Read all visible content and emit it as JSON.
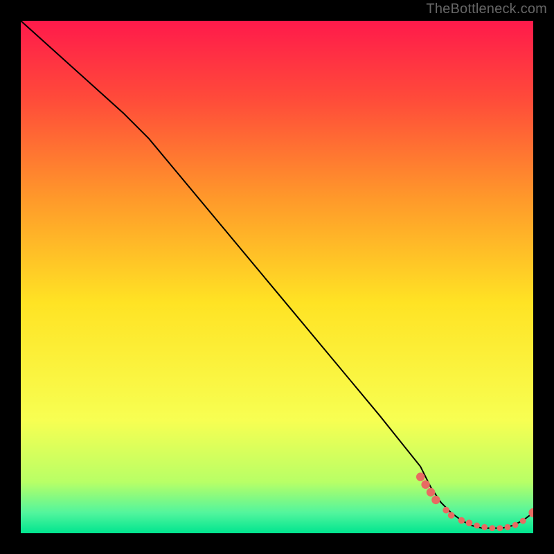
{
  "watermark": "TheBottleneck.com",
  "chart_data": {
    "type": "line",
    "title": "",
    "xlabel": "",
    "ylabel": "",
    "xlim": [
      0,
      100
    ],
    "ylim": [
      0,
      100
    ],
    "background": {
      "type": "vertical_gradient",
      "stops": [
        {
          "offset": 0.0,
          "color": "#ff1a4b"
        },
        {
          "offset": 0.15,
          "color": "#ff4a3a"
        },
        {
          "offset": 0.35,
          "color": "#ff9a2a"
        },
        {
          "offset": 0.55,
          "color": "#ffe324"
        },
        {
          "offset": 0.78,
          "color": "#f7ff52"
        },
        {
          "offset": 0.9,
          "color": "#b8ff66"
        },
        {
          "offset": 0.96,
          "color": "#52f59d"
        },
        {
          "offset": 1.0,
          "color": "#00e58f"
        }
      ]
    },
    "series": [
      {
        "name": "bottleneck-curve",
        "color": "#000000",
        "x": [
          0,
          10,
          20,
          25,
          30,
          40,
          50,
          60,
          70,
          78,
          80,
          82,
          84,
          86,
          88,
          90,
          92,
          94,
          96,
          98,
          100
        ],
        "y": [
          100,
          91,
          82,
          77,
          71,
          59,
          47,
          35,
          23,
          13,
          9,
          6,
          4,
          2.5,
          1.5,
          1,
          1,
          1,
          1.5,
          2.5,
          4
        ]
      }
    ],
    "markers": {
      "name": "bottleneck-markers",
      "color": "#e86a62",
      "points": [
        {
          "x": 78,
          "y": 11,
          "r": 2.8
        },
        {
          "x": 79,
          "y": 9.5,
          "r": 2.8
        },
        {
          "x": 80,
          "y": 8,
          "r": 2.8
        },
        {
          "x": 81,
          "y": 6.5,
          "r": 2.8
        },
        {
          "x": 83,
          "y": 4.5,
          "r": 2.2
        },
        {
          "x": 84,
          "y": 3.5,
          "r": 2.2
        },
        {
          "x": 86,
          "y": 2.5,
          "r": 2.2
        },
        {
          "x": 87.5,
          "y": 2,
          "r": 2.2
        },
        {
          "x": 89,
          "y": 1.5,
          "r": 2.0
        },
        {
          "x": 90.5,
          "y": 1.2,
          "r": 2.0
        },
        {
          "x": 92,
          "y": 1.0,
          "r": 2.0
        },
        {
          "x": 93.5,
          "y": 1.0,
          "r": 2.0
        },
        {
          "x": 95,
          "y": 1.2,
          "r": 2.0
        },
        {
          "x": 96.5,
          "y": 1.6,
          "r": 2.0
        },
        {
          "x": 98,
          "y": 2.4,
          "r": 2.0
        },
        {
          "x": 100,
          "y": 4.0,
          "r": 3.0
        }
      ]
    }
  }
}
